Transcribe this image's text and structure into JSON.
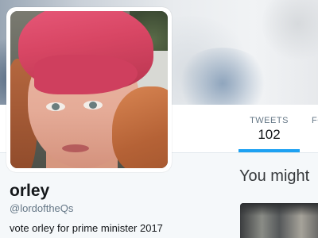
{
  "profile": {
    "name": "orley",
    "handle": "@lordoftheQs",
    "bio": "vote orley for prime minister 2017"
  },
  "nav": {
    "tabs": [
      {
        "label": "TWEETS",
        "count": "102",
        "active": true
      },
      {
        "label": "FOLLOWING",
        "count": ""
      }
    ]
  },
  "sidebar": {
    "who_to_follow_heading": "You might"
  },
  "colors": {
    "accent": "#1da1f2",
    "background": "#f5f8fa",
    "muted_text": "#657786"
  }
}
